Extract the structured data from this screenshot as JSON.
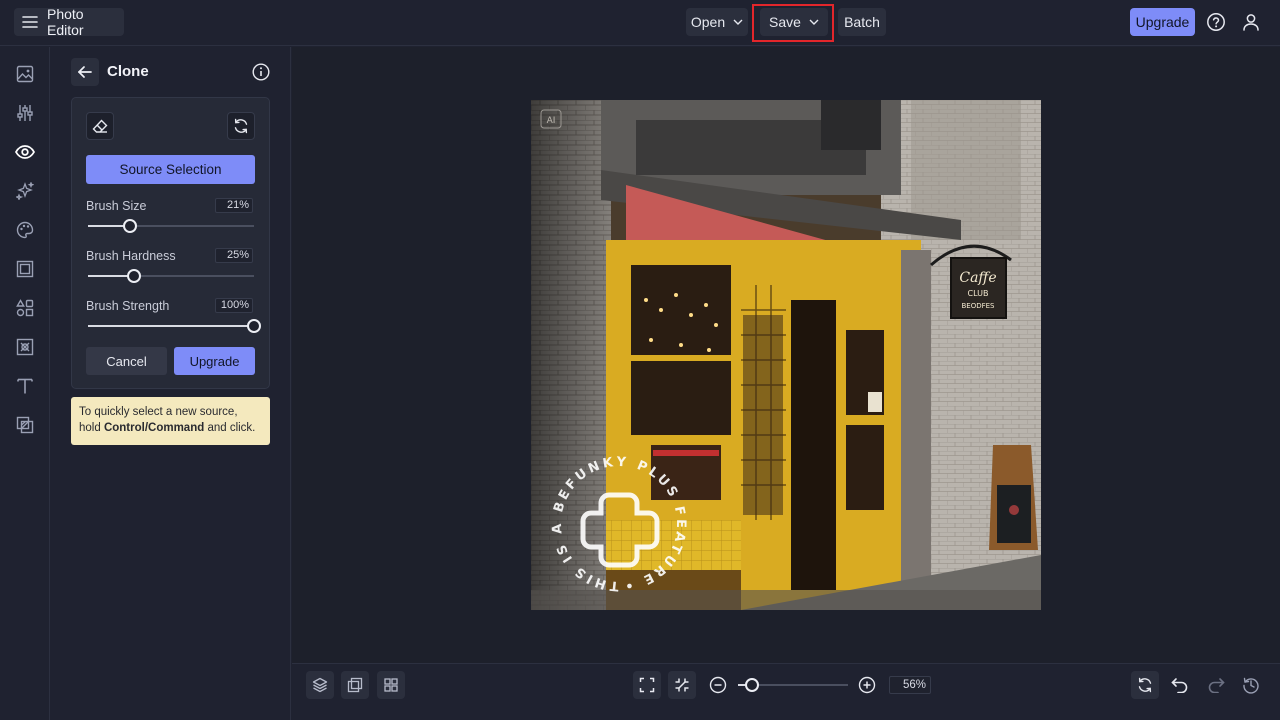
{
  "app": {
    "title": "Photo Editor",
    "menu_icon": "hamburger-menu-icon"
  },
  "header": {
    "open_label": "Open",
    "save_label": "Save",
    "batch_label": "Batch",
    "upgrade_label": "Upgrade",
    "help_icon": "help-circle-icon",
    "account_icon": "user-icon"
  },
  "rail": {
    "items": [
      {
        "name": "image-icon",
        "active": false
      },
      {
        "name": "sliders-icon",
        "active": false
      },
      {
        "name": "eye-icon",
        "active": true
      },
      {
        "name": "sparkles-icon",
        "active": false
      },
      {
        "name": "palette-icon",
        "active": false
      },
      {
        "name": "frame-icon",
        "active": false
      },
      {
        "name": "shapes-icon",
        "active": false
      },
      {
        "name": "texture-icon",
        "active": false
      },
      {
        "name": "text-icon",
        "active": false
      },
      {
        "name": "graphics-icon",
        "active": false
      }
    ]
  },
  "panel": {
    "title": "Clone",
    "source_selection_label": "Source Selection",
    "sliders": [
      {
        "label": "Brush Size",
        "value": "21",
        "unit": "%",
        "fraction": 0.25
      },
      {
        "label": "Brush Hardness",
        "value": "25",
        "unit": "%",
        "fraction": 0.28
      },
      {
        "label": "Brush Strength",
        "value": "100",
        "unit": "%",
        "fraction": 1.0
      }
    ],
    "cancel_label": "Cancel",
    "upgrade_label": "Upgrade",
    "tip": {
      "before": "To quickly select a new source, hold ",
      "bold": "Control/Command",
      "after": " and click."
    }
  },
  "canvas": {
    "watermark_text": "THIS IS A BEFUNKY PLUS FEATURE •",
    "sign_line1": "Caffe",
    "sign_line2": "CLUB",
    "sign_line3": "BEODFES"
  },
  "bottom": {
    "zoom_value": "56",
    "zoom_unit": "%",
    "zoom_fraction": 0.13
  },
  "colors": {
    "accent": "#7e8cf8",
    "highlight": "#e3262b",
    "tip_bg": "#f4e9be"
  }
}
